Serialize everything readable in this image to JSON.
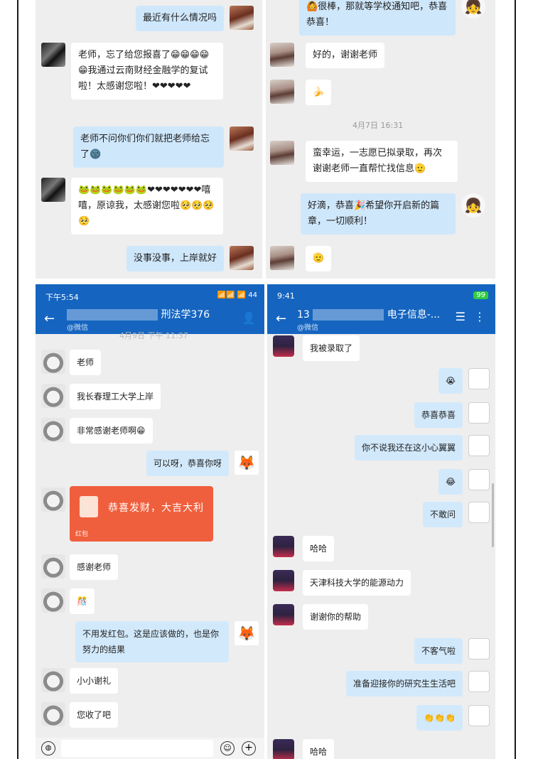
{
  "panel1": {
    "messages": [
      "最近有什么情况吗",
      "老师，忘了给您报喜了😁😁😁😁😁我通过云南财经金融学的复试啦！太感谢您啦！❤❤❤❤❤",
      "老师不问你们你们就把老师给忘了🌚",
      "🐸🐸🐸🐸🐸🐸❤❤❤❤❤❤❤嘻嘻，原谅我，太感谢您啦🥺🥺🥺🥺",
      "没事没事，上岸就好"
    ]
  },
  "panel2": {
    "messages": [
      "🙆很棒，那就等学校通知吧，恭喜恭喜！",
      "好的，谢谢老师",
      "🍌",
      "蛮幸运，一志愿已拟录取，再次谢谢老师一直帮忙找信息🫡",
      "好滴，恭喜🎉希望你开启新的篇章，一切顺利！",
      "🫡"
    ],
    "timestamp": "4月7日  16:31"
  },
  "panel3": {
    "status_time": "下午5:54",
    "status_right": "📶📶 📶 44",
    "title": "刑法学376",
    "subtitle": "@微信",
    "timestamp_partial": "4月9日 下午 11:37",
    "messages": [
      "老师",
      "我长春理工大学上岸",
      "非常感谢老师啊😁",
      "可以呀，恭喜你呀",
      "感谢老师",
      "🎊",
      "不用发红包。这是应该做的，也是你努力的结果",
      "小小谢礼",
      "您收了吧"
    ],
    "redpacket": {
      "title": "恭喜发财，大吉大利",
      "label": "红包"
    }
  },
  "panel4": {
    "status_time": "9:41",
    "status_right": "99",
    "title_prefix": "13",
    "title_suffix": "电子信息-...",
    "subtitle": "@微信",
    "messages": [
      "我被录取了",
      "😭",
      "恭喜恭喜",
      "你不说我还在这小心翼翼",
      "😂",
      "不敢问",
      "哈哈",
      "天津科技大学的能源动力",
      "谢谢你的帮助",
      "不客气啦",
      "准备迎接你的研究生生活吧",
      "👏👏👏",
      "哈哈"
    ]
  }
}
